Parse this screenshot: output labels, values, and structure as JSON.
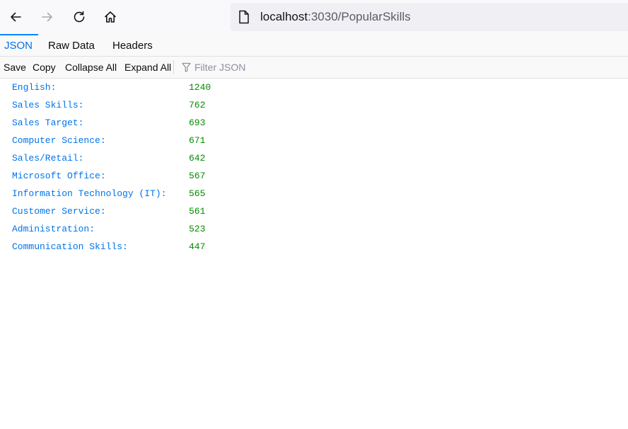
{
  "browser": {
    "url_host": "localhost",
    "url_rest": ":3030/PopularSkills",
    "icons": [
      "back-arrow-icon",
      "forward-arrow-icon",
      "reload-icon",
      "home-icon",
      "page-icon"
    ]
  },
  "viewer": {
    "tabs": [
      {
        "label": "JSON",
        "selected": true
      },
      {
        "label": "Raw Data",
        "selected": false
      },
      {
        "label": "Headers",
        "selected": false
      }
    ],
    "toolbar": {
      "save": "Save",
      "copy": "Copy",
      "collapse_all": "Collapse All",
      "expand_all": "Expand All",
      "filter_placeholder": "Filter JSON"
    },
    "rows": [
      {
        "key": "English:",
        "value": "1240"
      },
      {
        "key": "Sales Skills:",
        "value": "762"
      },
      {
        "key": "Sales Target:",
        "value": "693"
      },
      {
        "key": "Computer Science:",
        "value": "671"
      },
      {
        "key": "Sales/Retail:",
        "value": "642"
      },
      {
        "key": "Microsoft Office:",
        "value": "567"
      },
      {
        "key": "Information Technology (IT):",
        "value": "565"
      },
      {
        "key": "Customer Service:",
        "value": "561"
      },
      {
        "key": "Administration:",
        "value": "523"
      },
      {
        "key": "Communication Skills:",
        "value": "447"
      }
    ]
  },
  "colors": {
    "key": "#0074e8",
    "number": "#058b00",
    "selected_tab": "#0a84ff"
  }
}
